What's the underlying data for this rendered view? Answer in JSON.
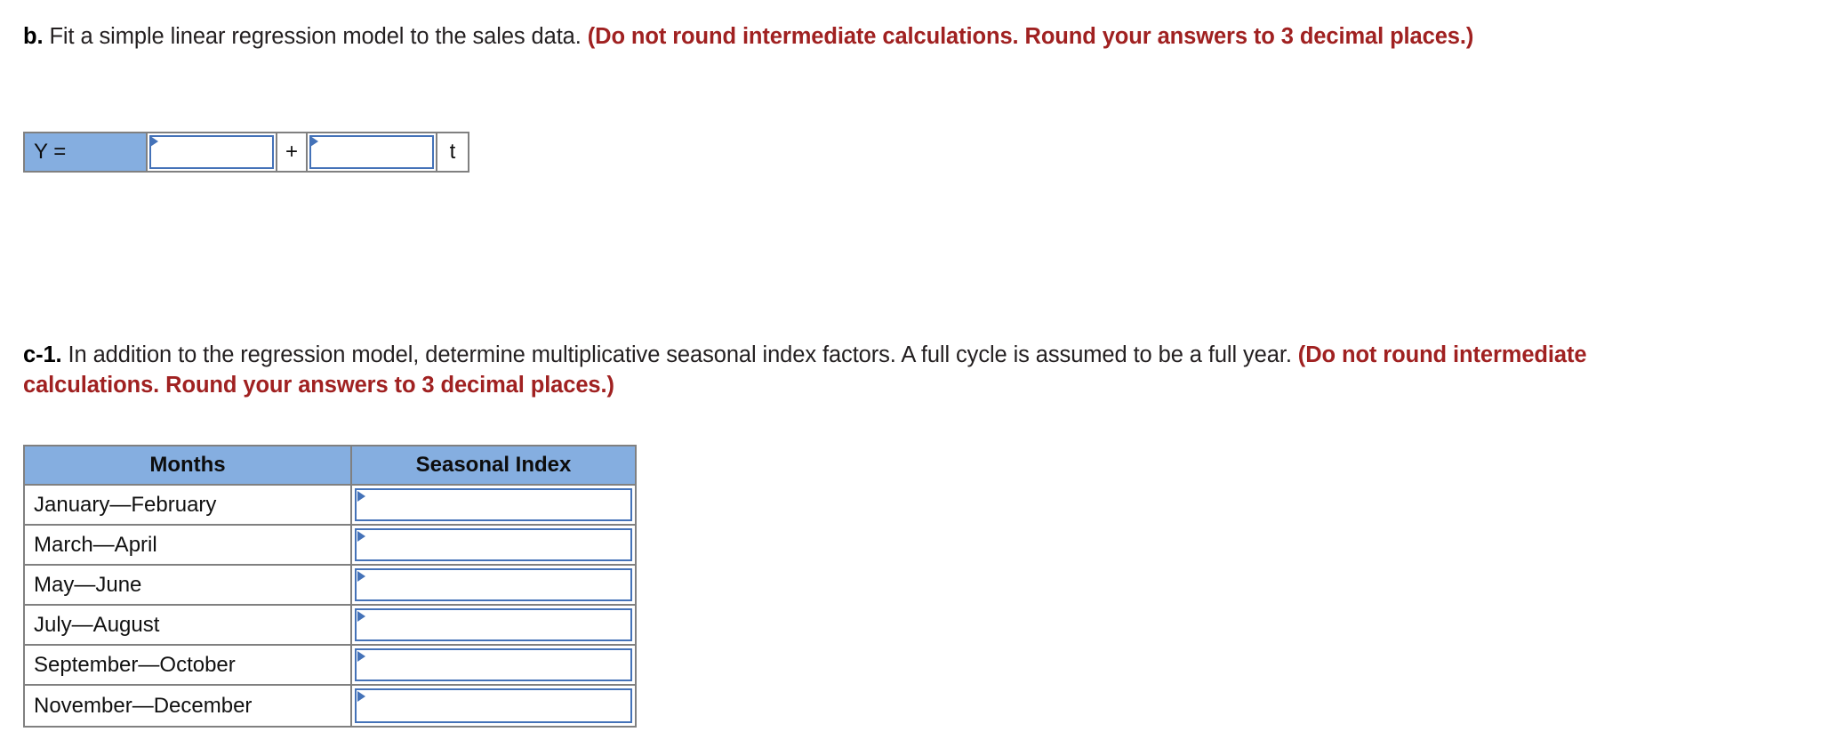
{
  "part_b": {
    "prefix": "b.",
    "text": " Fit a simple linear regression model to the sales data. ",
    "note": "(Do not round intermediate calculations. Round your answers to 3 decimal places.)"
  },
  "equation": {
    "label": "Y =",
    "intercept_value": "",
    "intercept_placeholder": "",
    "operator": "+",
    "slope_value": "",
    "slope_placeholder": "",
    "variable": "t"
  },
  "part_c1": {
    "prefix": "c-1.",
    "text": " In addition to the regression model, determine multiplicative seasonal index factors. A full cycle is assumed to be a full year. ",
    "note": "(Do not round intermediate calculations. Round your answers to 3 decimal places.)"
  },
  "table": {
    "headers": [
      "Months",
      "Seasonal Index"
    ],
    "rows": [
      {
        "months": "January—February",
        "seasonal_index": ""
      },
      {
        "months": "March—April",
        "seasonal_index": ""
      },
      {
        "months": "May—June",
        "seasonal_index": ""
      },
      {
        "months": "July—August",
        "seasonal_index": ""
      },
      {
        "months": "September—October",
        "seasonal_index": ""
      },
      {
        "months": "November—December",
        "seasonal_index": ""
      }
    ]
  },
  "colors": {
    "header_blue": "#85aee0",
    "input_border_blue": "#4472b8",
    "note_red": "#a02121",
    "grid_gray": "#808080"
  }
}
